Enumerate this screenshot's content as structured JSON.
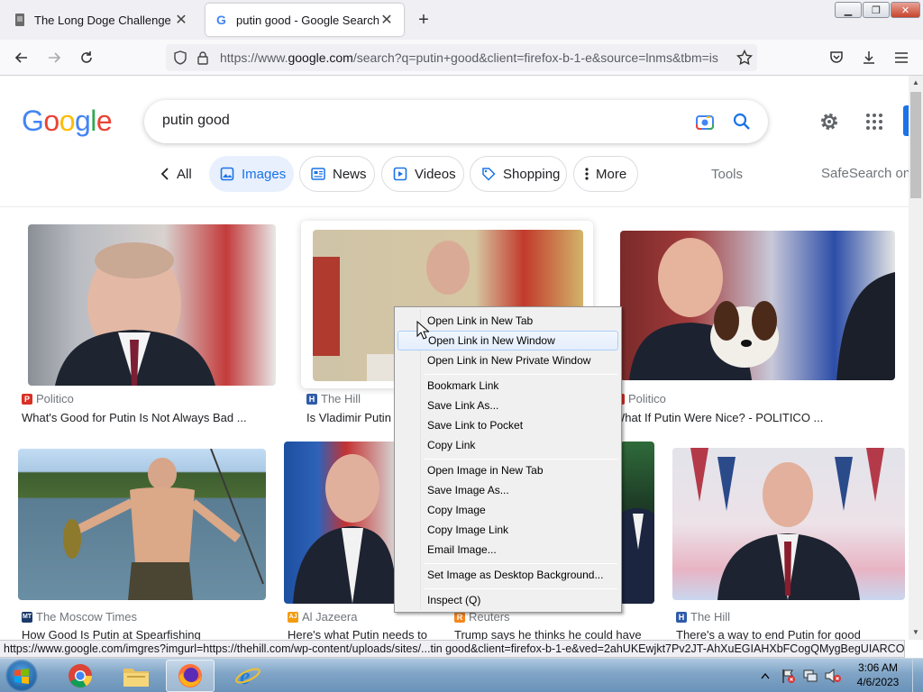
{
  "browser": {
    "tabs": [
      {
        "title": "The Long Doge Challenge",
        "active": false
      },
      {
        "title": "putin good - Google Search",
        "active": true
      }
    ],
    "url_prefix": "https://www.",
    "url_domain": "google.com",
    "url_rest": "/search?q=putin+good&client=firefox-b-1-e&source=lnms&tbm=is",
    "status_url": "https://www.google.com/imgres?imgurl=https://thehill.com/wp-content/uploads/sites/...tin good&client=firefox-b-1-e&ved=2ahUKEwjkt7Pv2JT-AhXuEGIAHXbFCogQMygBegUIARCOAQ"
  },
  "google": {
    "logo": [
      "G",
      "o",
      "o",
      "g",
      "l",
      "e"
    ],
    "logo_colors": [
      "#4285F4",
      "#EA4335",
      "#FBBC05",
      "#4285F4",
      "#34A853",
      "#EA4335"
    ],
    "query": "putin good",
    "chips": {
      "all": "All",
      "images": "Images",
      "news": "News",
      "videos": "Videos",
      "shopping": "Shopping",
      "more": "More"
    },
    "tools": "Tools",
    "safesearch": "SafeSearch on"
  },
  "results": [
    {
      "source": "Politico",
      "title": "What's Good for Putin Is Not Always Bad ...",
      "fav": "P",
      "fav_color": "#d93025"
    },
    {
      "source": "The Hill",
      "title": "Is Vladimir Putin r",
      "fav": "H",
      "fav_color": "#2e5aa8"
    },
    {
      "source": "Politico",
      "title": "What If Putin Were Nice? - POLITICO ...",
      "fav": "P",
      "fav_color": "#d93025"
    },
    {
      "source": "The Moscow Times",
      "title": "How Good Is Putin at Spearfishing",
      "fav": "MT",
      "fav_color": "#1b3a6b"
    },
    {
      "source": "Al Jazeera",
      "title": "Here's what Putin needs to",
      "fav": "AJ",
      "fav_color": "#f39c12"
    },
    {
      "source": "Reuters",
      "title": "Trump says he thinks he could have a",
      "fav": "R",
      "fav_color": "#f5871f"
    },
    {
      "source": "The Hill",
      "title": "There's a way to end Putin for good",
      "fav": "H",
      "fav_color": "#2e5aa8"
    }
  ],
  "context_menu": {
    "items": [
      "Open Link in New Tab",
      "Open Link in New Window",
      "Open Link in New Private Window",
      "Bookmark Link",
      "Save Link As...",
      "Save Link to Pocket",
      "Copy Link",
      "Open Image in New Tab",
      "Save Image As...",
      "Copy Image",
      "Copy Image Link",
      "Email Image...",
      "Set Image as Desktop Background...",
      "Inspect (Q)"
    ],
    "highlighted_index": 1
  },
  "taskbar": {
    "time": "3:06 AM",
    "date": "4/6/2023"
  }
}
